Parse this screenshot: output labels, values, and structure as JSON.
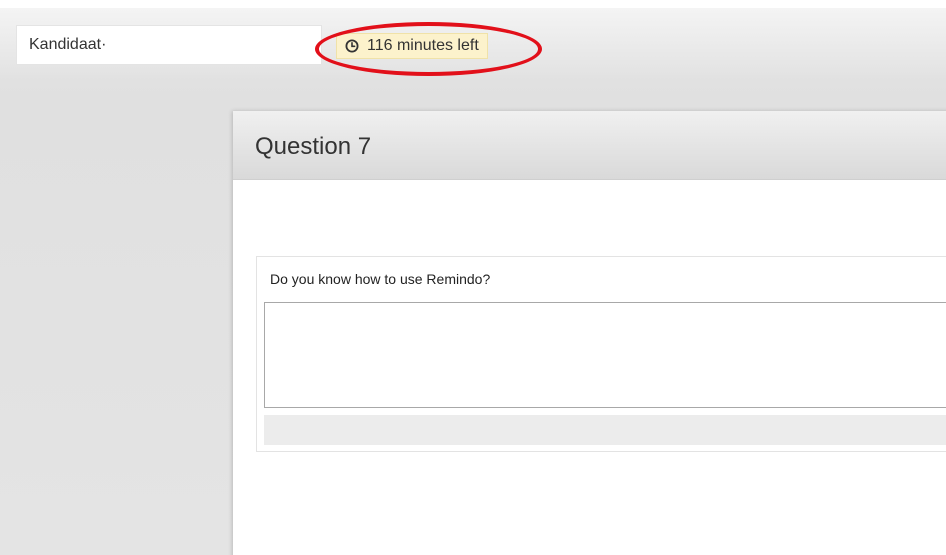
{
  "header": {
    "candidate_label": "Kandidaat·",
    "timer_text": "116 minutes left",
    "timer_icon": "clock-icon"
  },
  "question": {
    "title": "Question 7",
    "prompt": "Do you know how to use Remindo?",
    "answer_value": ""
  },
  "colors": {
    "highlight_ellipse": "#e2101a",
    "timer_background": "#fcf2cc"
  }
}
